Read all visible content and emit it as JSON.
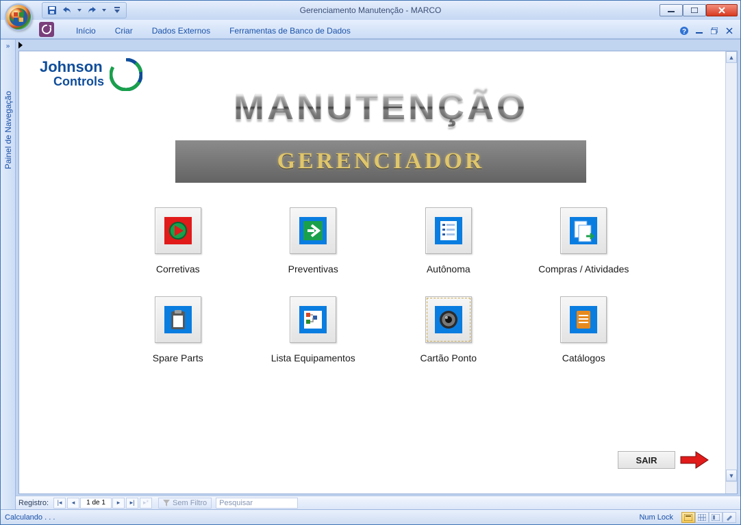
{
  "window": {
    "title": "Gerenciamento Manutenção - MARCO"
  },
  "ribbon": {
    "tabs": [
      "Início",
      "Criar",
      "Dados Externos",
      "Ferramentas de Banco de Dados"
    ]
  },
  "navpane": {
    "label": "Painel de Navegação",
    "expand_glyph": "»"
  },
  "form": {
    "logo_line1": "Johnson",
    "logo_line2": "Controls",
    "big_title": "MANUTENÇÃO",
    "sub_title": "GERENCIADOR",
    "tiles": [
      {
        "label": "Corretivas"
      },
      {
        "label": "Preventivas"
      },
      {
        "label": "Autônoma"
      },
      {
        "label": "Compras / Atividades"
      },
      {
        "label": "Spare Parts"
      },
      {
        "label": "Lista Equipamentos"
      },
      {
        "label": "Cartão Ponto"
      },
      {
        "label": "Catálogos"
      }
    ],
    "exit_label": "SAIR"
  },
  "recordnav": {
    "label": "Registro:",
    "position": "1 de 1",
    "filter_label": "Sem Filtro",
    "search_placeholder": "Pesquisar"
  },
  "statusbar": {
    "left": "Calculando . . .",
    "numlock": "Num Lock"
  }
}
